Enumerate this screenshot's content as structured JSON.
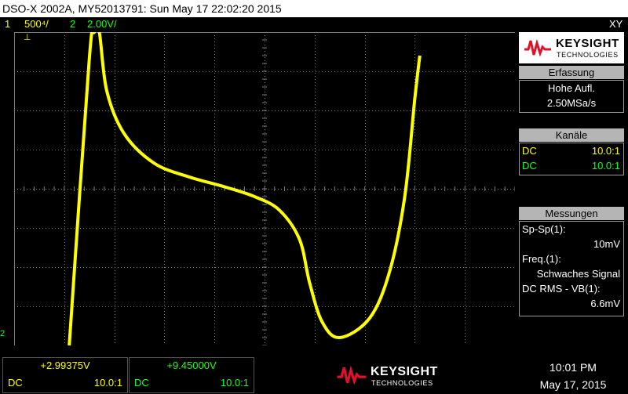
{
  "title_bar": {
    "text": "DSO-X 2002A, MY52013791: Sun May 17 22:02:20 2015"
  },
  "channel_bar": {
    "ch1": {
      "number": "1",
      "scale": "500⁴/",
      "color": "#ffff00"
    },
    "ch2": {
      "number": "2",
      "scale": "2.00V/",
      "color": "#19ff19"
    },
    "mode": "XY"
  },
  "markers": {
    "ch1": "⊥",
    "ch2": "2"
  },
  "right_panel": {
    "logo": {
      "name": "KEYSIGHT",
      "sub": "TECHNOLOGIES"
    },
    "acquisition": {
      "header": "Erfassung",
      "mode": "Hohe Aufl.",
      "rate": "2.50MSa/s"
    },
    "channels": {
      "header": "Kanäle",
      "rows": [
        {
          "coupling": "DC",
          "probe": "10.0:1",
          "color": "#ffff00"
        },
        {
          "coupling": "DC",
          "probe": "10.0:1",
          "color": "#19ff19"
        }
      ]
    },
    "measurements": {
      "header": "Messungen",
      "items": [
        {
          "label": "Sp-Sp(1):",
          "value": "10mV"
        },
        {
          "label": "Freq.(1):",
          "value": "Schwaches Signal"
        },
        {
          "label": "DC RMS - VB(1):",
          "value": "6.6mV"
        }
      ]
    }
  },
  "bottom": {
    "ch1": {
      "value": "+2.99375V",
      "coupling": "DC",
      "probe": "10.0:1",
      "color": "#ffff00"
    },
    "ch2": {
      "value": "+9.45000V",
      "coupling": "DC",
      "probe": "10.0:1",
      "color": "#19ff19"
    },
    "logo": {
      "name": "KEYSIGHT",
      "sub": "TECHNOLOGIES"
    },
    "time": "10:01 PM",
    "date": "May 17, 2015"
  },
  "colors": {
    "trace": "#ffff00",
    "grid": "#7a7a7a",
    "ch2": "#19ff19",
    "logo_red": "#e0102a"
  },
  "trace": {
    "color": "#ffff00",
    "points": [
      [
        -3.9,
        -4
      ],
      [
        -3.5,
        3.3
      ],
      [
        -3.4,
        4
      ],
      [
        -3.3,
        4
      ],
      [
        -3.15,
        2.5
      ],
      [
        -2.8,
        1.4
      ],
      [
        -2.2,
        0.65
      ],
      [
        -1.5,
        0.3
      ],
      [
        -0.8,
        0.05
      ],
      [
        -0.2,
        -0.2
      ],
      [
        0.3,
        -0.55
      ],
      [
        0.7,
        -1.3
      ],
      [
        0.9,
        -2.4
      ],
      [
        1.15,
        -3.4
      ],
      [
        1.5,
        -3.8
      ],
      [
        2.1,
        -3.3
      ],
      [
        2.5,
        -2.1
      ],
      [
        2.8,
        -0.2
      ],
      [
        3.0,
        2.3
      ],
      [
        3.1,
        3.4
      ]
    ]
  }
}
